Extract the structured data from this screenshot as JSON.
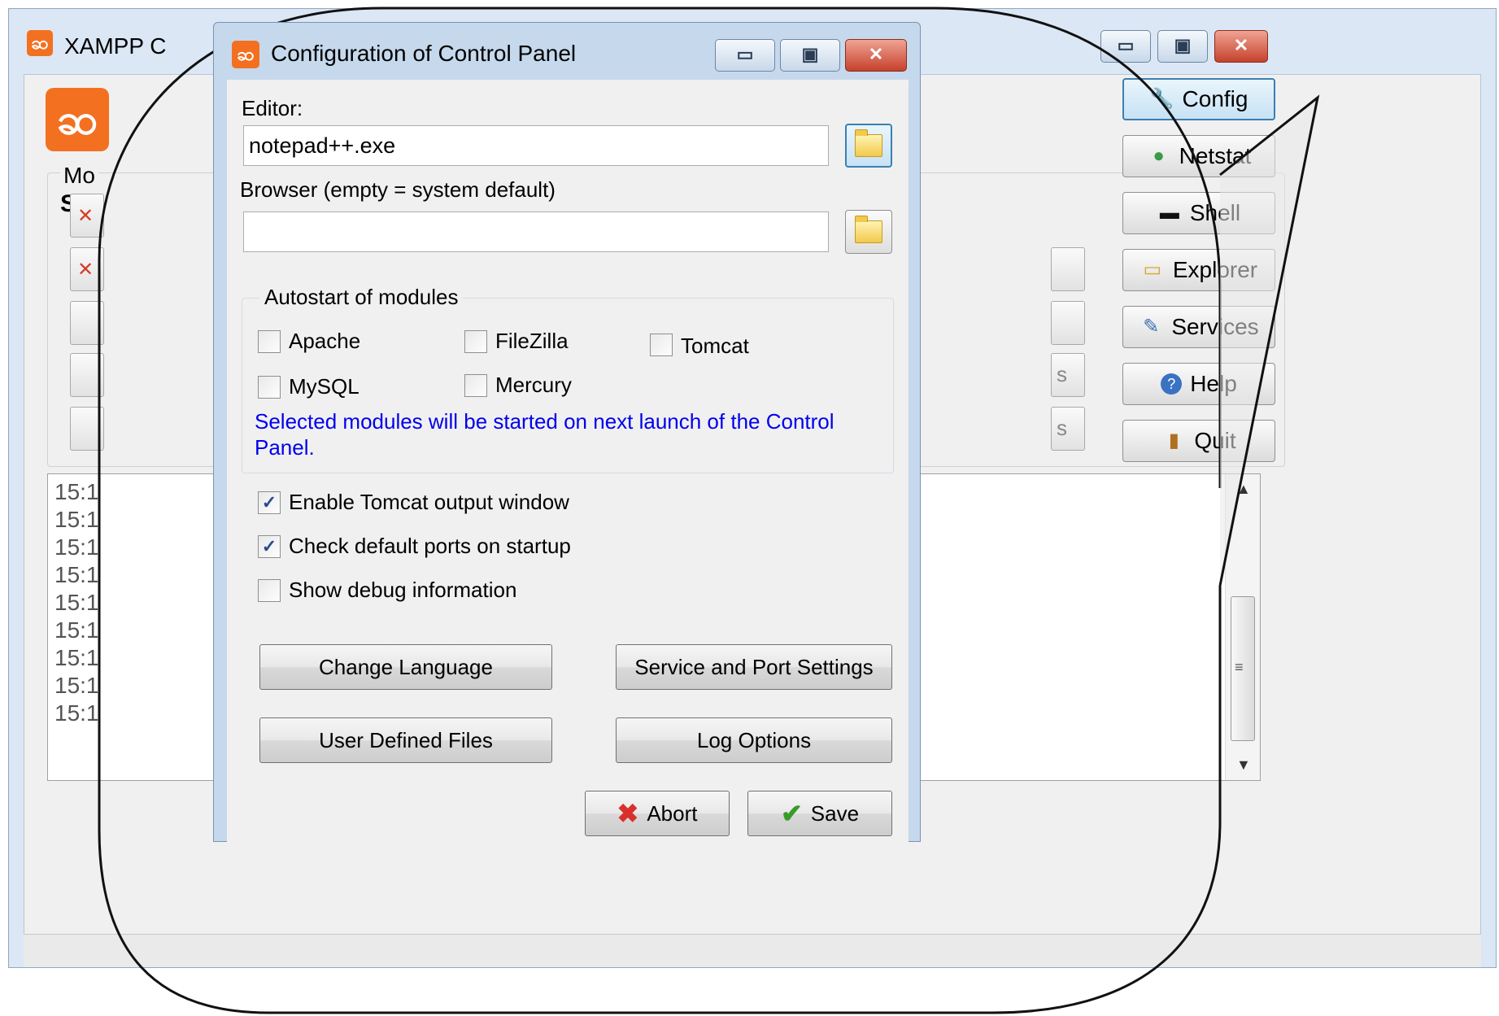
{
  "main_window": {
    "title": "XAMPP C",
    "logo_glyph": "ဆ",
    "modules_label": "Mo",
    "service_label": "Ser",
    "window_buttons": {
      "minimize": "▭",
      "maximize": "▣",
      "close": "✕"
    },
    "side_buttons": [
      {
        "label": "Config",
        "icon": "wrench-icon",
        "glyph": "🔧"
      },
      {
        "label": "Netstat",
        "icon": "globe-icon",
        "glyph": "●"
      },
      {
        "label": "Shell",
        "icon": "terminal-icon",
        "glyph": "▬"
      },
      {
        "label": "Explorer",
        "icon": "folder-icon",
        "glyph": "▭"
      },
      {
        "label": "Services",
        "icon": "services-icon",
        "glyph": "✎"
      },
      {
        "label": "Help",
        "icon": "help-icon",
        "glyph": "?"
      },
      {
        "label": "Quit",
        "icon": "door-icon",
        "glyph": "▮"
      }
    ],
    "log_lines": [
      "15:1",
      "15:1",
      "15:1",
      "15:1",
      "15:1",
      "15:1",
      "15:1",
      "15:1",
      "15:1"
    ],
    "partial_button_text": [
      "s",
      "s"
    ],
    "scroll": {
      "up": "▲",
      "down": "▼",
      "grip": "≡"
    }
  },
  "dialog": {
    "title": "Configuration of Control Panel",
    "icon_glyph": "ဆ",
    "window_buttons": {
      "minimize": "▭",
      "maximize": "▣",
      "close": "✕"
    },
    "editor": {
      "label": "Editor:",
      "value": "notepad++.exe"
    },
    "browser": {
      "label": "Browser (empty = system default)",
      "value": ""
    },
    "autostart": {
      "legend": "Autostart of modules",
      "modules": [
        {
          "label": "Apache",
          "checked": false
        },
        {
          "label": "FileZilla",
          "checked": false
        },
        {
          "label": "Tomcat",
          "checked": false
        },
        {
          "label": "MySQL",
          "checked": false
        },
        {
          "label": "Mercury",
          "checked": false
        }
      ],
      "info": "Selected modules will be started on next launch of the Control Panel."
    },
    "options": [
      {
        "label": "Enable Tomcat output window",
        "checked": true
      },
      {
        "label": "Check default ports on startup",
        "checked": true
      },
      {
        "label": "Show debug information",
        "checked": false
      }
    ],
    "buttons": {
      "change_language": "Change Language",
      "service_port": "Service and Port Settings",
      "user_files": "User Defined Files",
      "log_options": "Log Options",
      "abort": "Abort",
      "save": "Save"
    },
    "check_glyph": "✓",
    "abort_glyph": "✖",
    "save_glyph": "✔"
  }
}
